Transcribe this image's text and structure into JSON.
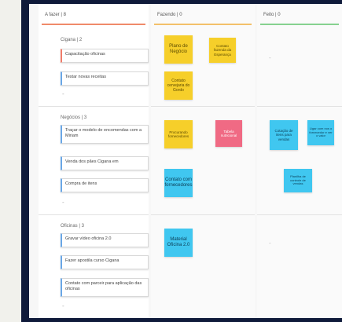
{
  "columns": [
    {
      "label": "A fazer  |  8"
    },
    {
      "label": "Fazendo  |  0"
    },
    {
      "label": "Feito  |  0"
    }
  ],
  "lanes": [
    {
      "title": "Cigana  |  2",
      "cards": [
        "Capacitação oficinas",
        "Testar novas receitas"
      ],
      "stickies_fazendo": [
        "Plano de Negócio",
        "Contato fazenda da Esperança",
        "Contato cervejaria do Gordo"
      ],
      "stickies_feito": []
    },
    {
      "title": "Negócios  |  3",
      "cards": [
        "Traçar o modelo de encomendas com a Miriam",
        "Venda dos pães Cigana em",
        "Compra de itens"
      ],
      "stickies_fazendo": [
        "Procurando fornecedores",
        "Tabela nutricional",
        "Contato com fornecedores"
      ],
      "stickies_feito": [
        "Cotação de itens para vendas",
        "Ligar com nos o fornecedor e ver o valor",
        "Planilha de controle de vendas"
      ]
    },
    {
      "title": "Oficinas  |  3",
      "cards": [
        "Gravar vídeo oficina 2.0",
        "Fazer apostila curso Cigana",
        "Contato com parceir para aplicação das oficinas"
      ],
      "stickies_fazendo": [
        "Material Oficina 2.0"
      ],
      "stickies_feito": []
    }
  ],
  "empty_marker": "-",
  "colors": {
    "frame": "#0f1a3a",
    "yellow": "#f6cf2a",
    "pink": "#f06a84",
    "blue": "#40c7f0"
  }
}
